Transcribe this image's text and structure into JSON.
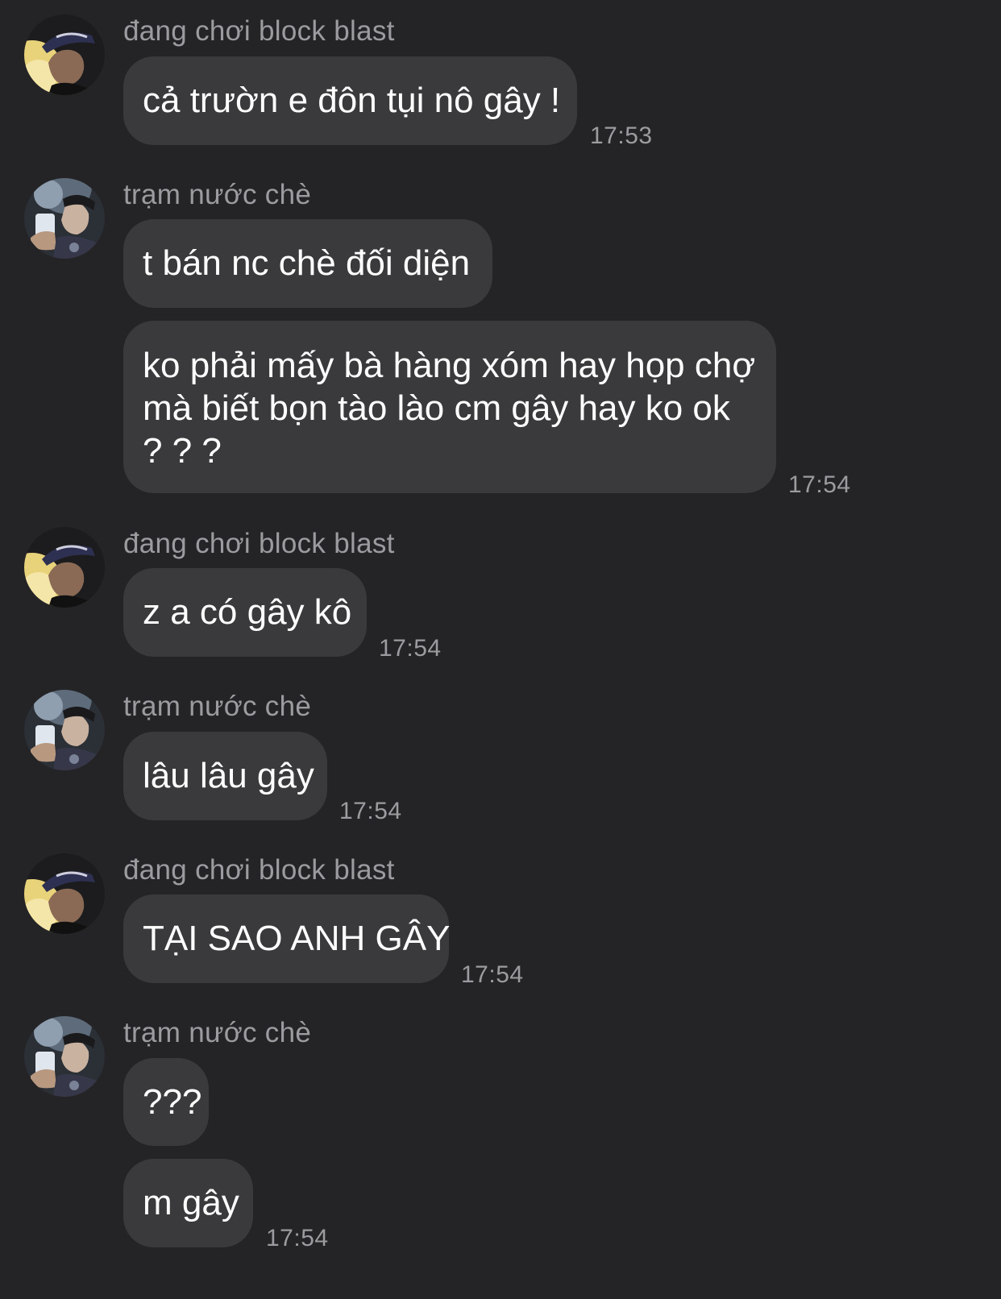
{
  "contacts": {
    "block_blast": {
      "name": "đang chơi block blast",
      "avatar_icon": "profile-photo-cap"
    },
    "tram_nuoc_che": {
      "name": "trạm nước chè",
      "avatar_icon": "profile-photo-drink"
    }
  },
  "messages": [
    {
      "sender": "đang chơi block blast",
      "texts": [
        "cả trườn e đôn tụi nô gây !"
      ],
      "time": "17:53"
    },
    {
      "sender": "trạm nước chè",
      "texts": [
        "t bán nc chè đối diện",
        "ko phải mấy bà hàng xóm hay họp chợ mà biết bọn tào lào cm gây hay ko ok ? ? ?"
      ],
      "time": "17:54"
    },
    {
      "sender": "đang chơi block blast",
      "texts": [
        "z a có gây kô"
      ],
      "time": "17:54"
    },
    {
      "sender": "trạm nước chè",
      "texts": [
        "lâu lâu gây"
      ],
      "time": "17:54"
    },
    {
      "sender": "đang chơi block blast",
      "texts": [
        "TẠI SAO ANH GÂY"
      ],
      "time": "17:54"
    },
    {
      "sender": "trạm nước chè",
      "texts": [
        "???",
        "m gây"
      ],
      "time": "17:54"
    }
  ],
  "colors": {
    "background": "#242426",
    "bubble": "#3a3a3c",
    "text": "#ffffff",
    "secondary_text": "#9c9ca0"
  }
}
